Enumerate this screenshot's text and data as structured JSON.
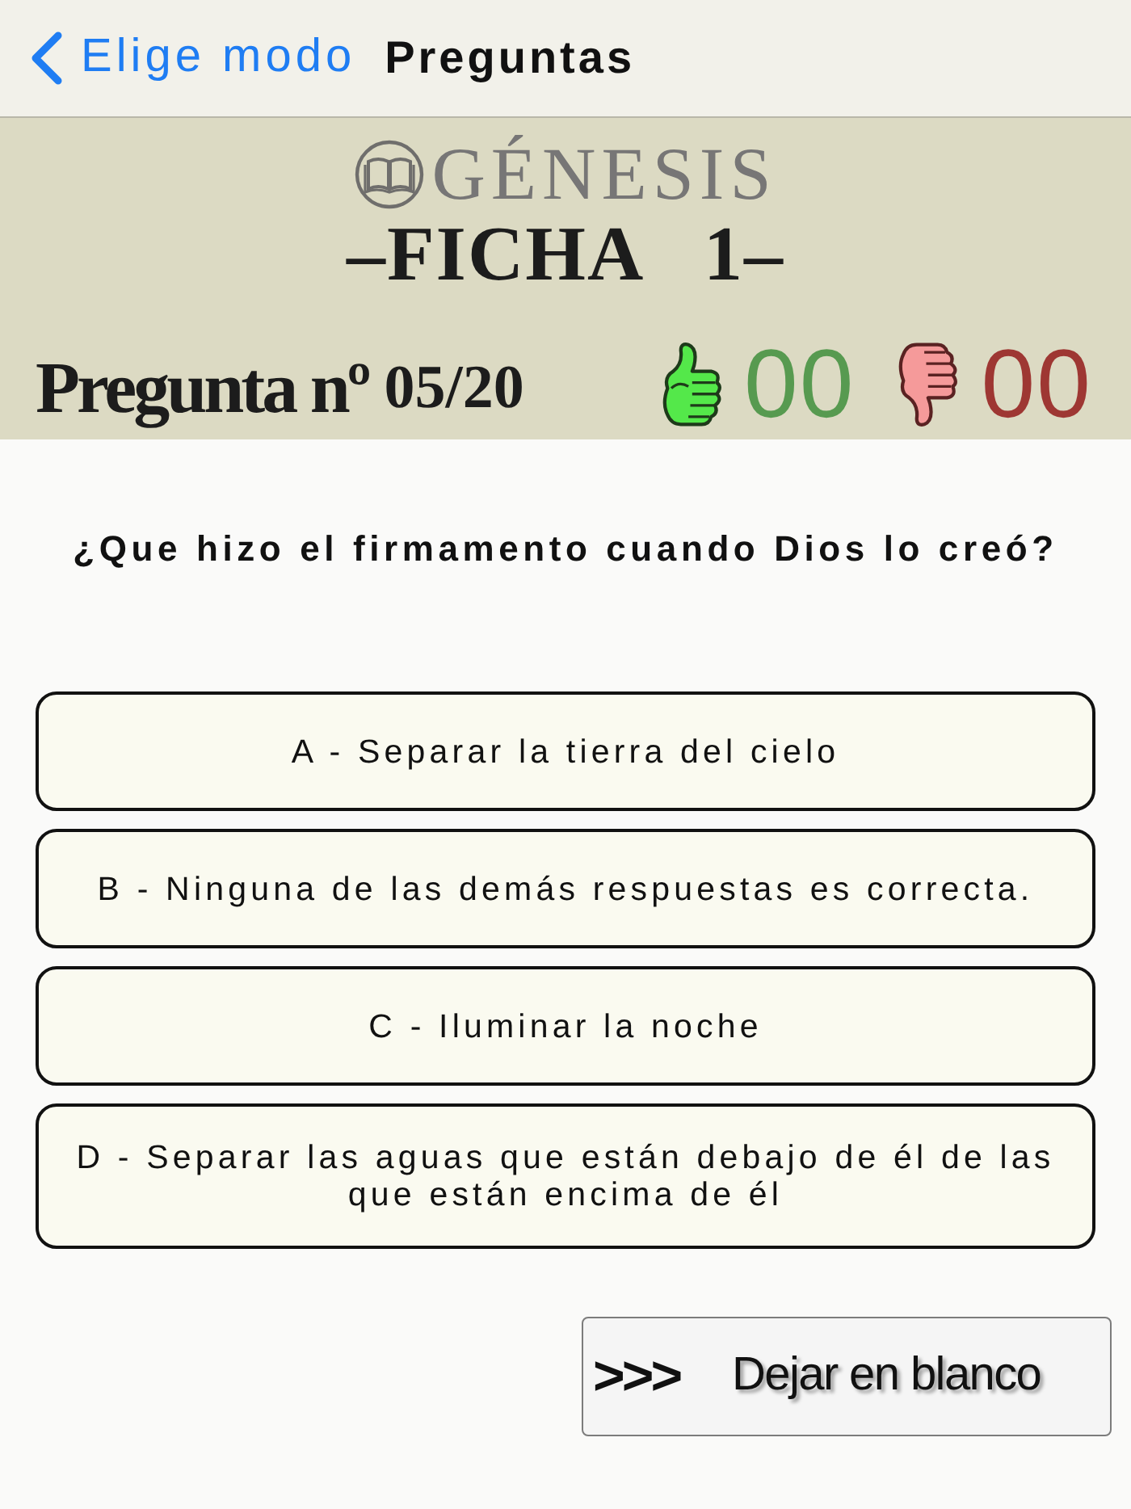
{
  "nav": {
    "back_label": "Elige modo",
    "title": "Preguntas"
  },
  "header": {
    "book": "GÉNESIS",
    "sheet": "–FICHA 1–",
    "question_label": "Pregunta nº",
    "question_counter": "05/20",
    "scores": [
      {
        "kind": "correct",
        "count": "00"
      },
      {
        "kind": "wrong",
        "count": "00"
      }
    ]
  },
  "question": "¿Que hizo el firmamento cuando Dios lo creó?",
  "answers": [
    "A - Separar la tierra del cielo",
    "B - Ninguna de las demás respuestas es correcta.",
    "C - Iluminar la noche",
    "D - Separar las aguas que están debajo de él de las que están encima de él"
  ],
  "skip_button": {
    "arrows": ">>>",
    "label": "Dejar en blanco"
  }
}
